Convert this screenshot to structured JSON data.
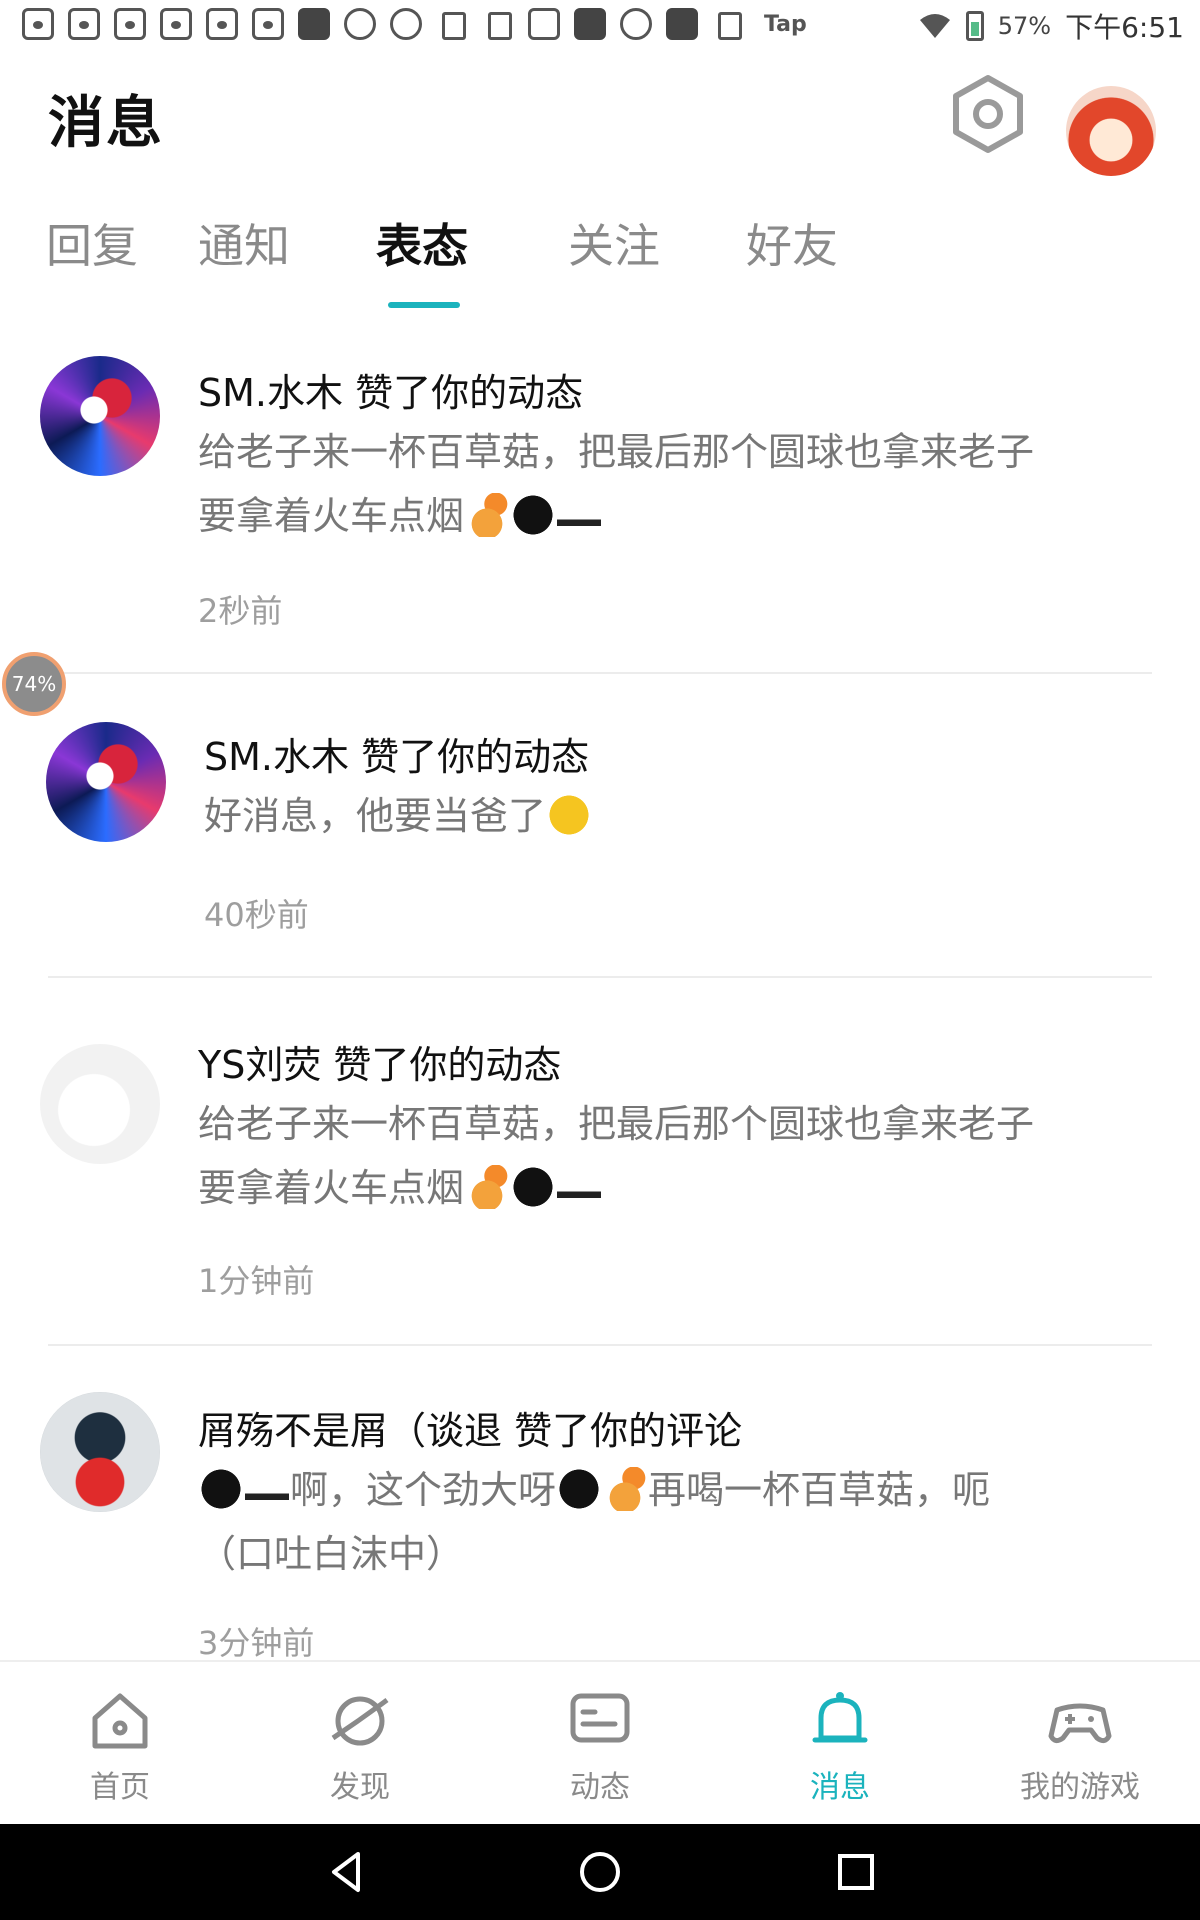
{
  "status_bar": {
    "tap_label": "Tap",
    "battery": "57%",
    "time": "下午6:51",
    "icons": [
      "baidu-paw-icon",
      "baidu-paw-icon",
      "baidu-paw-icon",
      "baidu-paw-icon",
      "baidu-paw-icon",
      "baidu-paw-icon",
      "capcut-icon",
      "gift-icon",
      "plus-circle-icon",
      "clipboard-icon",
      "document-icon",
      "image-icon",
      "gallery-icon",
      "camera-icon",
      "gallery-icon",
      "download-icon"
    ]
  },
  "header": {
    "title": "消息"
  },
  "tabs": [
    {
      "label": "回复"
    },
    {
      "label": "通知"
    },
    {
      "label": "表态"
    },
    {
      "label": "关注"
    },
    {
      "label": "好友"
    }
  ],
  "active_tab": "表态",
  "progress_bubble": "74%",
  "messages": [
    {
      "title": "SM.水木 赞了你的动态",
      "body_line1": "给老子来一杯百草菇，把最后那个圆球也拿来老子",
      "body_line2": "要拿着火车点烟",
      "time": "2秒前"
    },
    {
      "title": "SM.水木 赞了你的动态",
      "body_line1": "好消息，他要当爸了",
      "time": "40秒前"
    },
    {
      "title": "YS刘荧 赞了你的动态",
      "body_line1": "给老子来一杯百草菇，把最后那个圆球也拿来老子",
      "body_line2": "要拿着火车点烟",
      "time": "1分钟前"
    },
    {
      "title": "屑殇不是屑（谈退 赞了你的评论",
      "body_part1": "啊，这个劲大呀",
      "body_part2": "再喝一杯百草菇，呃",
      "body_line2": "（口吐白沫中）",
      "time": "3分钟前"
    }
  ],
  "bottom_nav": [
    {
      "label": "首页",
      "icon": "home-icon"
    },
    {
      "label": "发现",
      "icon": "discover-planet-icon"
    },
    {
      "label": "动态",
      "icon": "feed-message-icon"
    },
    {
      "label": "消息",
      "icon": "bell-icon"
    },
    {
      "label": "我的游戏",
      "icon": "gamepad-icon"
    }
  ],
  "colors": {
    "accent": "#1bb3bd",
    "text_primary": "#111111",
    "text_secondary": "#777777"
  }
}
